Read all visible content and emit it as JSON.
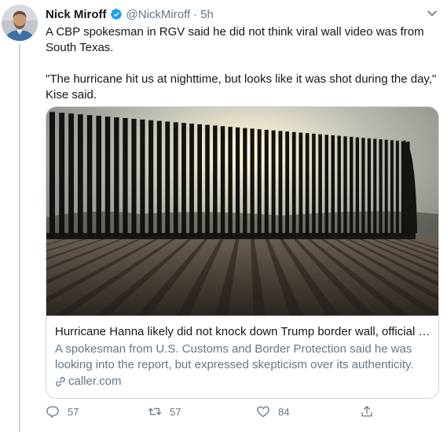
{
  "tweet": {
    "author_name": "Nick Miroff",
    "handle": "@NickMiroff",
    "separator": "·",
    "time": "5h",
    "paragraph1_line1": "A CBP spokesman in RGV said he did not think viral wall video was from",
    "paragraph1_line2": "South Texas.",
    "paragraph2_line1": "\"The hurricane hit us at nighttime, but looks like it was shot during the day,\"",
    "paragraph2_line2": "Kise said."
  },
  "card": {
    "title": "Hurricane Hanna likely did not knock down Trump border wall, official s...",
    "description_line1": "A spokesman from U.S. Customs and Border Protection said he was",
    "description_line2": "looking into the report, but expressed skepticism over its authenticity.",
    "domain": "caller.com"
  },
  "actions": {
    "reply_count": "57",
    "retweet_count": "57",
    "like_count": "84"
  },
  "colors": {
    "verified_blue": "#1da1f2",
    "secondary_text": "#657786",
    "border": "#ccd6dd"
  },
  "icons": [
    "verified-badge-icon",
    "chevron-down-icon",
    "link-icon",
    "reply-icon",
    "retweet-icon",
    "like-icon",
    "share-icon"
  ]
}
